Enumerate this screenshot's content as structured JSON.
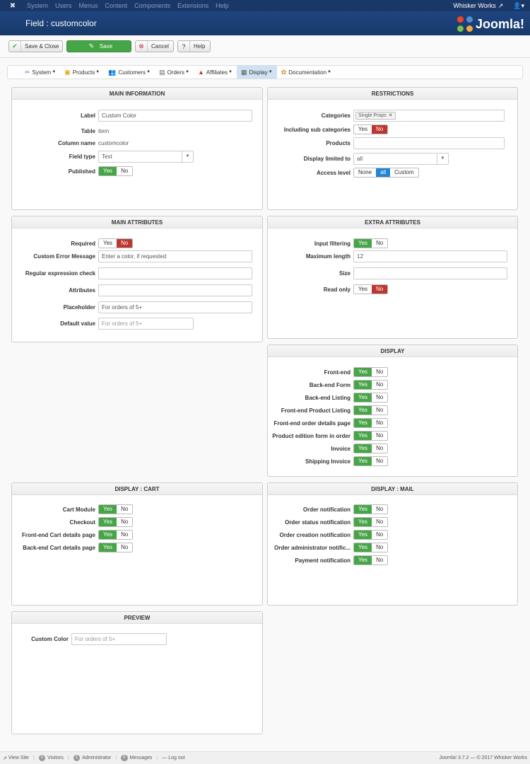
{
  "topbar": {
    "menu": [
      "System",
      "Users",
      "Menus",
      "Content",
      "Components",
      "Extensions",
      "Help"
    ],
    "site_name": "Whisker Works",
    "ext_icon": "external-link-icon",
    "user_icon": "user-icon"
  },
  "header": {
    "title": "Field : customcolor",
    "logo_text": "Joomla!"
  },
  "toolbar": {
    "save_close": "Save & Close",
    "save": "Save",
    "cancel": "Cancel",
    "help": "Help"
  },
  "submenu": [
    {
      "label": "System",
      "icon": "wrench-icon"
    },
    {
      "label": "Products",
      "icon": "box-icon"
    },
    {
      "label": "Customers",
      "icon": "users-icon"
    },
    {
      "label": "Orders",
      "icon": "document-icon"
    },
    {
      "label": "Affiliates",
      "icon": "chart-icon"
    },
    {
      "label": "Display",
      "icon": "display-icon",
      "active": true
    },
    {
      "label": "Documentation",
      "icon": "lifebuoy-icon"
    }
  ],
  "main_info": {
    "title": "MAIN INFORMATION",
    "label_lbl": "Label",
    "label_val": "Custom Color",
    "table_lbl": "Table",
    "table_val": "item",
    "column_lbl": "Column name",
    "column_val": "customcolor",
    "type_lbl": "Field type",
    "type_val": "Text",
    "published_lbl": "Published"
  },
  "restrictions": {
    "title": "RESTRICTIONS",
    "categories_lbl": "Categories",
    "categories_tag": "Single Props",
    "subcat_lbl": "Including sub categories",
    "products_lbl": "Products",
    "display_lbl": "Display limited to",
    "display_val": "all",
    "access_lbl": "Access level",
    "access_none": "None",
    "access_all": "all",
    "access_custom": "Custom"
  },
  "main_attr": {
    "title": "MAIN ATTRIBUTES",
    "required_lbl": "Required",
    "error_lbl": "Custom Error Message",
    "error_val": "Enter a color, if requested",
    "regex_lbl": "Regular expression check",
    "attributes_lbl": "Attributes",
    "placeholder_lbl": "Placeholder",
    "placeholder_val": "For orders of 5+",
    "default_lbl": "Default value",
    "default_placeholder": "For orders of 5+"
  },
  "extra_attr": {
    "title": "EXTRA ATTRIBUTES",
    "filtering_lbl": "Input filtering",
    "maxlen_lbl": "Maximum length",
    "maxlen_val": "12",
    "size_lbl": "Size",
    "readonly_lbl": "Read only"
  },
  "display": {
    "title": "DISPLAY",
    "rows": [
      "Front-end",
      "Back-end Form",
      "Back-end Listing",
      "Front-end Product Listing",
      "Front-end order details page",
      "Product edition form in order",
      "Invoice",
      "Shipping Invoice"
    ]
  },
  "display_cart": {
    "title": "DISPLAY : CART",
    "rows": [
      "Cart Module",
      "Checkout",
      "Front-end Cart details page",
      "Back-end Cart details page"
    ]
  },
  "display_mail": {
    "title": "DISPLAY : MAIL",
    "rows": [
      "Order notification",
      "Order status notification",
      "Order creation notification",
      "Order administrator notific...",
      "Payment notification"
    ]
  },
  "preview": {
    "title": "PREVIEW",
    "field_lbl": "Custom Color",
    "field_placeholder": "For orders of 5+"
  },
  "toggle": {
    "yes": "Yes",
    "no": "No"
  },
  "footer": {
    "view_site": "View Site",
    "visitors_count": "0",
    "visitors": "Visitors",
    "admin_count": "1",
    "admin": "Administrator",
    "messages_count": "0",
    "messages": "Messages",
    "logout": "Log out",
    "version": "Joomla! 3.7.2 — © 2017 Whisker Works"
  }
}
